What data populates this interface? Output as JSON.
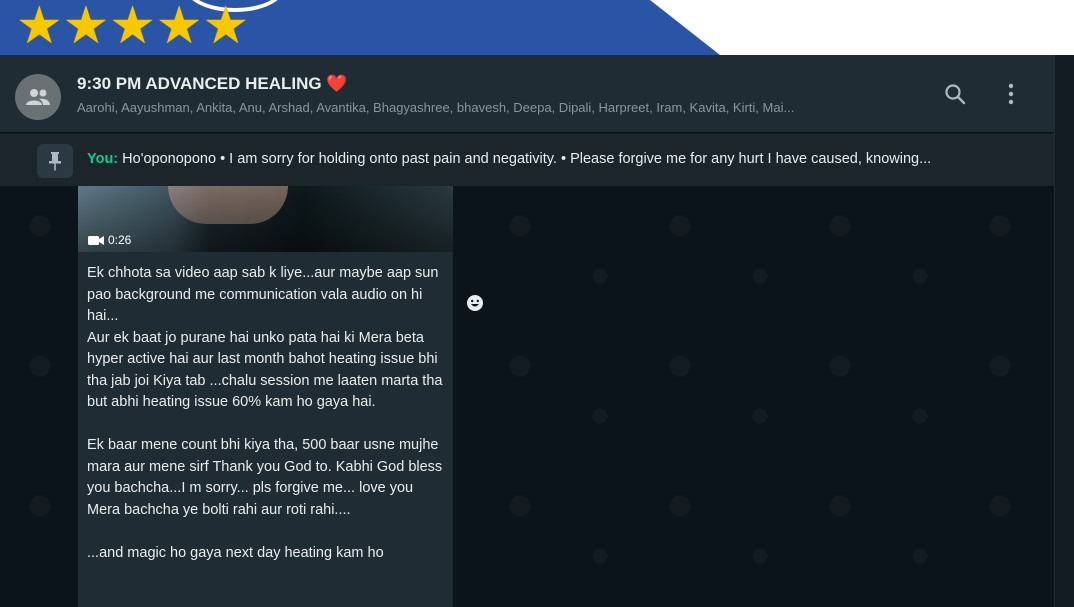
{
  "promo": {
    "stars": [
      "★",
      "★",
      "★",
      "★",
      "★"
    ]
  },
  "header": {
    "title": "9:30 PM ADVANCED HEALING ❤️",
    "subtitle": "Aarohi, Aayushman, Ankita, Anu, Arshad, Avantika, Bhagyashree, bhavesh, Deepa, Dipali, Harpreet, Iram, Kavita, Kirti, Mai...",
    "icons": [
      "group-avatar-icon",
      "search-icon",
      "menu-icon"
    ]
  },
  "pinned": {
    "sender": "You:",
    "text": " Ho'oponopono • I am sorry for holding onto past pain and negativity. • Please forgive me for any hurt I have caused, knowing..."
  },
  "message": {
    "video_duration": "0:26",
    "body": "Ek chhota sa video aap sab k liye...aur maybe aap sun pao background me communication vala audio on hi hai...\nAur ek baat jo purane hai unko pata hai ki Mera beta hyper active hai aur last month bahot heating issue bhi tha jab joi Kiya tab ...chalu session me laaten marta tha but abhi heating issue 60% kam ho gaya hai.\n\nEk baar mene count bhi kiya tha, 500 baar usne mujhe mara aur mene sirf Thank you God to. Kabhi God bless you bachcha...I m sorry... pls forgive me... love you Mera bachcha ye bolti rahi aur roti rahi....\n\n...and magic ho gaya next day heating kam ho"
  },
  "colors": {
    "accent": "#06cf9c",
    "promo_blue": "#2a55a6",
    "star": "#f7c800"
  }
}
